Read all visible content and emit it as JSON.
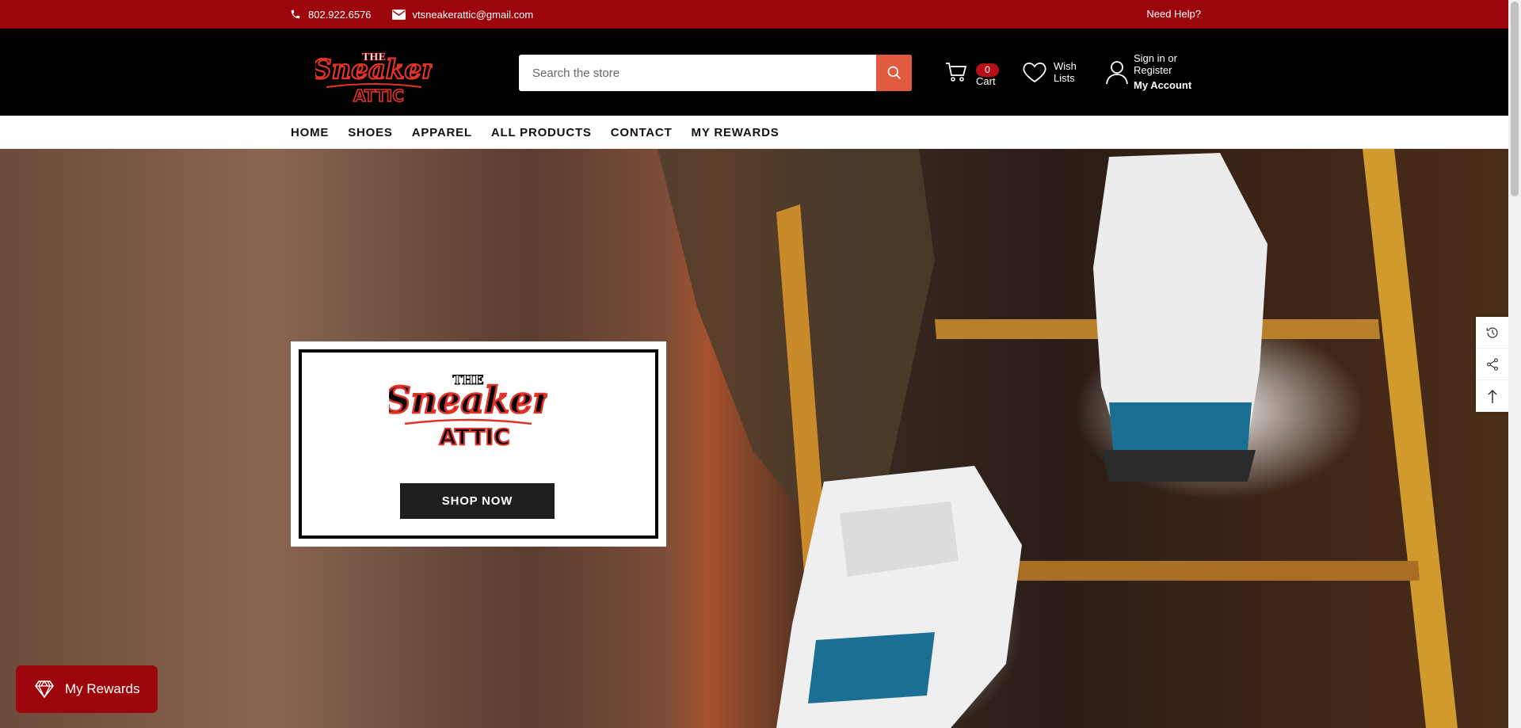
{
  "topbar": {
    "phone": "802.922.6576",
    "email": "vtsneakerattic@gmail.com",
    "help": "Need Help?"
  },
  "header": {
    "logo_text_top": "THE",
    "logo_text_main": "Sneaker",
    "logo_text_bottom": "ATTIC",
    "search_placeholder": "Search the store",
    "cart_count": "0",
    "cart_label": "Cart",
    "wish_line1": "Wish",
    "wish_line2": "Lists",
    "account_line1": "Sign in or",
    "account_line2": "Register",
    "account_line3": "My Account"
  },
  "nav": {
    "items": [
      "HOME",
      "SHOES",
      "APPAREL",
      "ALL PRODUCTS",
      "CONTACT",
      "MY REWARDS"
    ]
  },
  "hero": {
    "shop_now": "SHOP NOW"
  },
  "rewards": {
    "label": "My Rewards"
  },
  "colors": {
    "topbar": "#9b050b",
    "header": "#000000",
    "search_button": "#e05b3f",
    "rewards": "#9b050b"
  },
  "icons": [
    "phone-icon",
    "email-icon",
    "search-icon",
    "cart-icon",
    "heart-icon",
    "user-icon",
    "history-icon",
    "share-icon",
    "arrow-up-icon",
    "diamond-icon"
  ]
}
